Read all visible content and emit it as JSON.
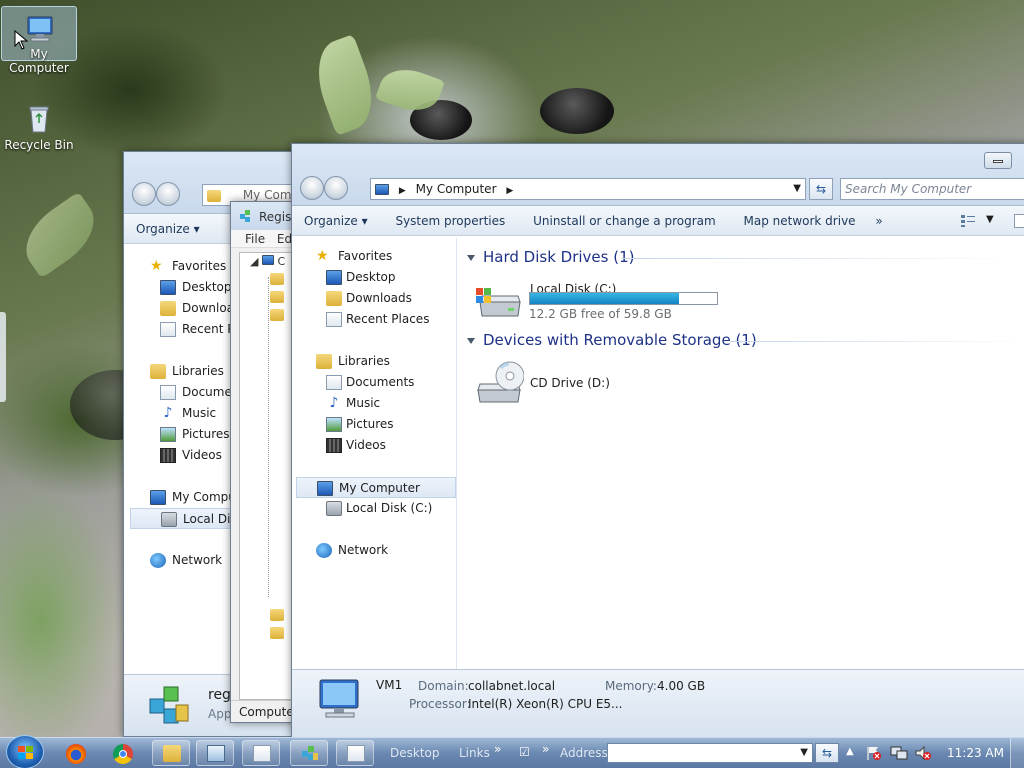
{
  "desktop": {
    "icons": [
      {
        "label": "My Computer"
      },
      {
        "label": "Recycle Bin"
      }
    ]
  },
  "back_window": {
    "address": "My Comp",
    "toolbar": {
      "organize": "Organize"
    },
    "nav": {
      "favorites": "Favorites",
      "desktop": "Desktop",
      "downloads": "Downloa",
      "recent": "Recent Pl",
      "libraries": "Libraries",
      "documents": "Documen",
      "music": "Music",
      "pictures": "Pictures",
      "videos": "Videos",
      "computer": "My Compu",
      "localdisk": "Local Dis",
      "network": "Network"
    },
    "details": {
      "name": "reg",
      "sub": "App"
    }
  },
  "regedit_window": {
    "title": "Regist",
    "menu": {
      "file": "File",
      "edit": "Ed"
    },
    "tree_root": "C",
    "status": "Compute"
  },
  "main_window": {
    "address": {
      "crumb": "My Computer"
    },
    "search_placeholder": "Search My Computer",
    "toolbar": {
      "organize": "Organize",
      "system_properties": "System properties",
      "uninstall": "Uninstall or change a program",
      "map_drive": "Map network drive",
      "more": "»"
    },
    "nav": {
      "favorites": "Favorites",
      "desktop": "Desktop",
      "downloads": "Downloads",
      "recent": "Recent Places",
      "libraries": "Libraries",
      "documents": "Documents",
      "music": "Music",
      "pictures": "Pictures",
      "videos": "Videos",
      "computer": "My Computer",
      "localdisk": "Local Disk (C:)",
      "network": "Network"
    },
    "groups": {
      "hdd_title": "Hard Disk Drives (1)",
      "removable_title": "Devices with Removable Storage (1)"
    },
    "drives": {
      "c_name": "Local Disk (C:)",
      "c_free": "12.2 GB free of 59.8 GB",
      "c_used_fraction": 0.796,
      "d_name": "CD Drive (D:)"
    },
    "details": {
      "name": "VM1",
      "domain_label": "Domain:",
      "domain": "collabnet.local",
      "memory_label": "Memory:",
      "memory": "4.00 GB",
      "processor_label": "Processor:",
      "processor": "Intel(R) Xeon(R) CPU E5..."
    }
  },
  "taskbar": {
    "desktop": "Desktop",
    "links": "Links",
    "chev1": "»",
    "chev2": "»",
    "address_label": "Address",
    "time": "11:23 AM"
  }
}
